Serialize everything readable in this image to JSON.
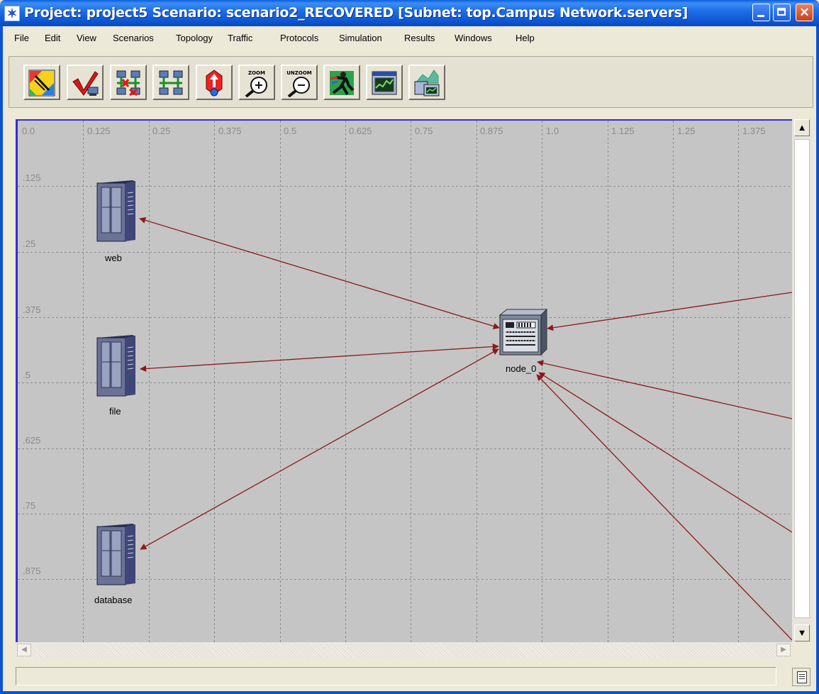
{
  "window": {
    "title": "Project: project5 Scenario: scenario2_RECOVERED  [Subnet: top.Campus Network.servers]",
    "app_icon": "opnet-star-icon"
  },
  "menu": [
    "File",
    "Edit",
    "View",
    "Scenarios",
    "Topology",
    "Traffic",
    "Protocols",
    "Simulation",
    "Results",
    "Windows",
    "Help"
  ],
  "toolbar": {
    "buttons": [
      {
        "name": "object-palette-button",
        "icon": "palette-icon"
      },
      {
        "name": "check-links-button",
        "icon": "check-links-icon"
      },
      {
        "name": "fail-link-button",
        "icon": "fail-link-icon"
      },
      {
        "name": "recover-link-button",
        "icon": "recover-link-icon"
      },
      {
        "name": "go-to-parent-subnet-button",
        "icon": "parent-subnet-icon"
      },
      {
        "name": "zoom-button",
        "icon": "zoom-in-icon",
        "label": "ZOOM"
      },
      {
        "name": "unzoom-button",
        "icon": "zoom-out-icon",
        "label": "UNZOOM"
      },
      {
        "name": "configure-run-simulation-button",
        "icon": "run-simulation-icon"
      },
      {
        "name": "view-results-button",
        "icon": "view-results-icon"
      },
      {
        "name": "hide-show-graphs-button",
        "icon": "graphs-icon"
      }
    ]
  },
  "workspace": {
    "x_ruler": [
      "0.0",
      "0.125",
      "0.25",
      "0.375",
      "0.5",
      "0.625",
      "0.75",
      "0.875",
      "1.0",
      "1.125",
      "1.25",
      "1.375"
    ],
    "y_ruler": [
      ".125",
      ".25",
      ".375",
      ".5",
      ".625",
      ".75",
      ".875"
    ],
    "nodes": [
      {
        "label": "web",
        "type": "server"
      },
      {
        "label": "file",
        "type": "server"
      },
      {
        "label": "database",
        "type": "server"
      },
      {
        "label": "node_0",
        "type": "switch"
      }
    ],
    "link_color": "#8b1a1a",
    "background_color": "#c5c5c5"
  },
  "statusbar": {
    "text": ""
  }
}
